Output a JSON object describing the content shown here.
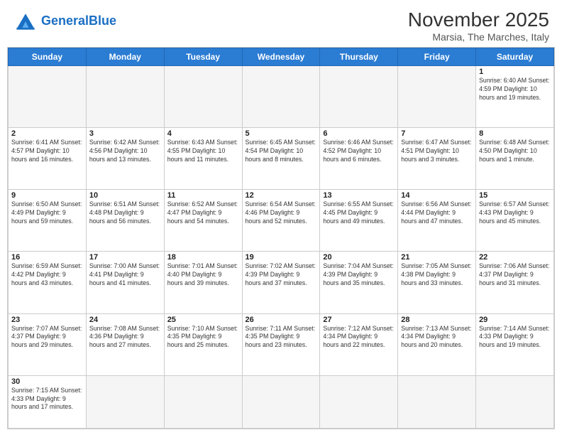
{
  "header": {
    "logo_general": "General",
    "logo_blue": "Blue",
    "month_year": "November 2025",
    "location": "Marsia, The Marches, Italy"
  },
  "days_of_week": [
    "Sunday",
    "Monday",
    "Tuesday",
    "Wednesday",
    "Thursday",
    "Friday",
    "Saturday"
  ],
  "weeks": [
    [
      {
        "day": null,
        "info": null
      },
      {
        "day": null,
        "info": null
      },
      {
        "day": null,
        "info": null
      },
      {
        "day": null,
        "info": null
      },
      {
        "day": null,
        "info": null
      },
      {
        "day": null,
        "info": null
      },
      {
        "day": "1",
        "info": "Sunrise: 6:40 AM\nSunset: 4:59 PM\nDaylight: 10 hours and 19 minutes."
      }
    ],
    [
      {
        "day": "2",
        "info": "Sunrise: 6:41 AM\nSunset: 4:57 PM\nDaylight: 10 hours and 16 minutes."
      },
      {
        "day": "3",
        "info": "Sunrise: 6:42 AM\nSunset: 4:56 PM\nDaylight: 10 hours and 13 minutes."
      },
      {
        "day": "4",
        "info": "Sunrise: 6:43 AM\nSunset: 4:55 PM\nDaylight: 10 hours and 11 minutes."
      },
      {
        "day": "5",
        "info": "Sunrise: 6:45 AM\nSunset: 4:54 PM\nDaylight: 10 hours and 8 minutes."
      },
      {
        "day": "6",
        "info": "Sunrise: 6:46 AM\nSunset: 4:52 PM\nDaylight: 10 hours and 6 minutes."
      },
      {
        "day": "7",
        "info": "Sunrise: 6:47 AM\nSunset: 4:51 PM\nDaylight: 10 hours and 3 minutes."
      },
      {
        "day": "8",
        "info": "Sunrise: 6:48 AM\nSunset: 4:50 PM\nDaylight: 10 hours and 1 minute."
      }
    ],
    [
      {
        "day": "9",
        "info": "Sunrise: 6:50 AM\nSunset: 4:49 PM\nDaylight: 9 hours and 59 minutes."
      },
      {
        "day": "10",
        "info": "Sunrise: 6:51 AM\nSunset: 4:48 PM\nDaylight: 9 hours and 56 minutes."
      },
      {
        "day": "11",
        "info": "Sunrise: 6:52 AM\nSunset: 4:47 PM\nDaylight: 9 hours and 54 minutes."
      },
      {
        "day": "12",
        "info": "Sunrise: 6:54 AM\nSunset: 4:46 PM\nDaylight: 9 hours and 52 minutes."
      },
      {
        "day": "13",
        "info": "Sunrise: 6:55 AM\nSunset: 4:45 PM\nDaylight: 9 hours and 49 minutes."
      },
      {
        "day": "14",
        "info": "Sunrise: 6:56 AM\nSunset: 4:44 PM\nDaylight: 9 hours and 47 minutes."
      },
      {
        "day": "15",
        "info": "Sunrise: 6:57 AM\nSunset: 4:43 PM\nDaylight: 9 hours and 45 minutes."
      }
    ],
    [
      {
        "day": "16",
        "info": "Sunrise: 6:59 AM\nSunset: 4:42 PM\nDaylight: 9 hours and 43 minutes."
      },
      {
        "day": "17",
        "info": "Sunrise: 7:00 AM\nSunset: 4:41 PM\nDaylight: 9 hours and 41 minutes."
      },
      {
        "day": "18",
        "info": "Sunrise: 7:01 AM\nSunset: 4:40 PM\nDaylight: 9 hours and 39 minutes."
      },
      {
        "day": "19",
        "info": "Sunrise: 7:02 AM\nSunset: 4:39 PM\nDaylight: 9 hours and 37 minutes."
      },
      {
        "day": "20",
        "info": "Sunrise: 7:04 AM\nSunset: 4:39 PM\nDaylight: 9 hours and 35 minutes."
      },
      {
        "day": "21",
        "info": "Sunrise: 7:05 AM\nSunset: 4:38 PM\nDaylight: 9 hours and 33 minutes."
      },
      {
        "day": "22",
        "info": "Sunrise: 7:06 AM\nSunset: 4:37 PM\nDaylight: 9 hours and 31 minutes."
      }
    ],
    [
      {
        "day": "23",
        "info": "Sunrise: 7:07 AM\nSunset: 4:37 PM\nDaylight: 9 hours and 29 minutes."
      },
      {
        "day": "24",
        "info": "Sunrise: 7:08 AM\nSunset: 4:36 PM\nDaylight: 9 hours and 27 minutes."
      },
      {
        "day": "25",
        "info": "Sunrise: 7:10 AM\nSunset: 4:35 PM\nDaylight: 9 hours and 25 minutes."
      },
      {
        "day": "26",
        "info": "Sunrise: 7:11 AM\nSunset: 4:35 PM\nDaylight: 9 hours and 23 minutes."
      },
      {
        "day": "27",
        "info": "Sunrise: 7:12 AM\nSunset: 4:34 PM\nDaylight: 9 hours and 22 minutes."
      },
      {
        "day": "28",
        "info": "Sunrise: 7:13 AM\nSunset: 4:34 PM\nDaylight: 9 hours and 20 minutes."
      },
      {
        "day": "29",
        "info": "Sunrise: 7:14 AM\nSunset: 4:33 PM\nDaylight: 9 hours and 19 minutes."
      }
    ],
    [
      {
        "day": "30",
        "info": "Sunrise: 7:15 AM\nSunset: 4:33 PM\nDaylight: 9 hours and 17 minutes."
      },
      {
        "day": null,
        "info": null
      },
      {
        "day": null,
        "info": null
      },
      {
        "day": null,
        "info": null
      },
      {
        "day": null,
        "info": null
      },
      {
        "day": null,
        "info": null
      },
      {
        "day": null,
        "info": null
      }
    ]
  ]
}
